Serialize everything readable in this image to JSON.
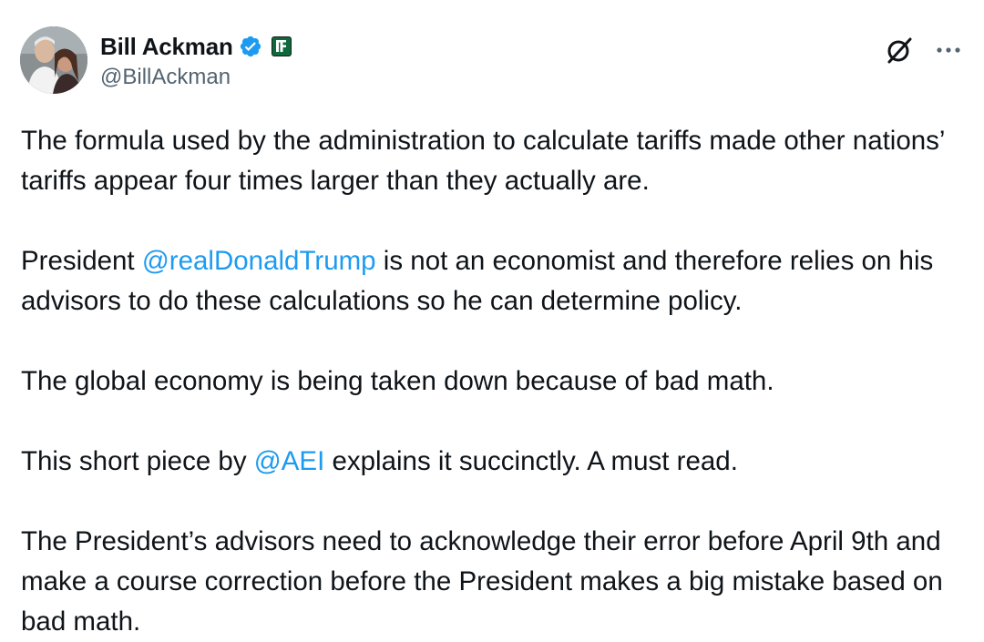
{
  "author": {
    "display_name": "Bill Ackman",
    "handle": "@BillAckman",
    "verified_color": "#1d9bf0",
    "affiliate_badge_icon": "affiliate-logo-icon"
  },
  "actions": {
    "grok_icon": "grok-icon",
    "more_icon": "more-options-icon"
  },
  "tweet": {
    "p1": "The formula used by the administration  to calculate tariffs made other nations’ tariffs appear four times larger than they actually are.",
    "p2_before": "President ",
    "p2_mention": "@realDonaldTrump",
    "p2_after": " is not an economist and therefore relies on his advisors to do these calculations so he can determine policy.",
    "p3": "The global economy is being taken down because of bad math.",
    "p4_before": "This short piece by ",
    "p4_mention": "@AEI",
    "p4_after": " explains it succinctly. A must read.",
    "p5": "The President’s advisors need to acknowledge their error before April 9th and make a course correction before the President makes a big mistake based on bad math."
  },
  "colors": {
    "text": "#0f1419",
    "secondary": "#536471",
    "link": "#1d9bf0"
  }
}
